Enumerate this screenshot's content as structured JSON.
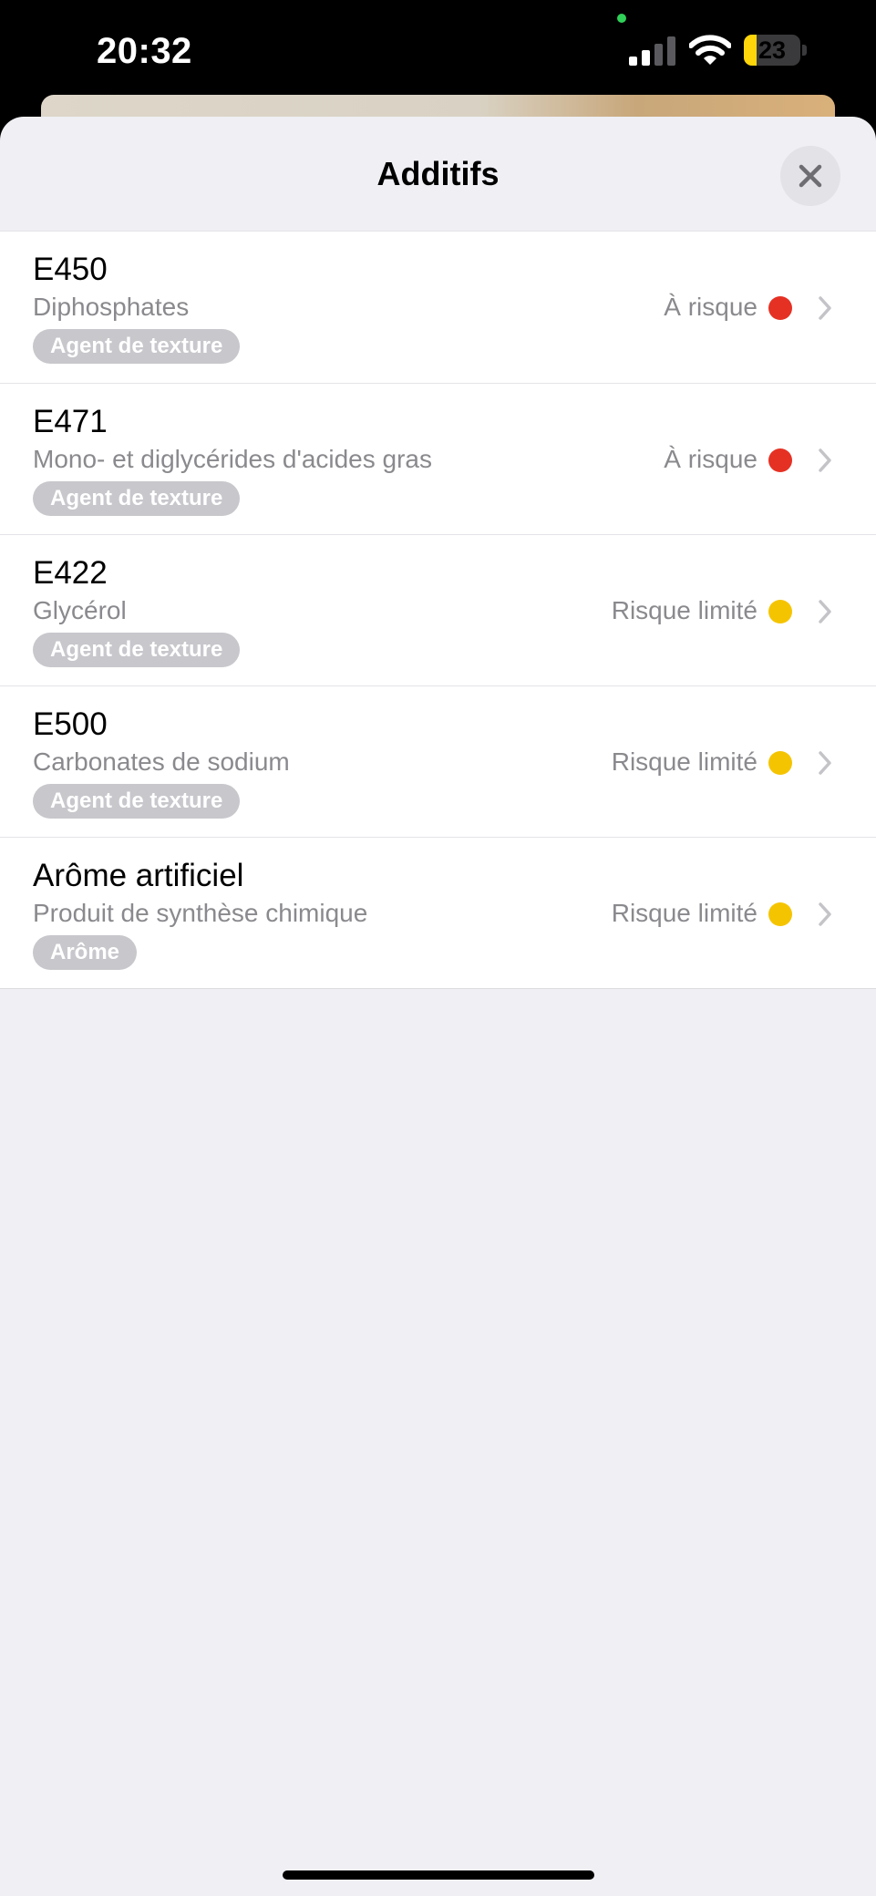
{
  "status_bar": {
    "time": "20:32",
    "battery_level": "23",
    "battery_fraction": 0.23,
    "signal_bars_active": 2,
    "signal_bars_total": 4,
    "icons": [
      "signal-icon",
      "wifi-icon",
      "battery-icon"
    ]
  },
  "sheet": {
    "title": "Additifs",
    "close_icon": "close-icon"
  },
  "additives": [
    {
      "code": "E450",
      "name": "Diphosphates",
      "tag": "Agent de texture",
      "risk": "À risque",
      "risk_color": "#e53124"
    },
    {
      "code": "E471",
      "name": "Mono- et diglycérides d'acides gras",
      "tag": "Agent de texture",
      "risk": "À risque",
      "risk_color": "#e53124"
    },
    {
      "code": "E422",
      "name": "Glycérol",
      "tag": "Agent de texture",
      "risk": "Risque limité",
      "risk_color": "#f5c400"
    },
    {
      "code": "E500",
      "name": "Carbonates de sodium",
      "tag": "Agent de texture",
      "risk": "Risque limité",
      "risk_color": "#f5c400"
    },
    {
      "code": "Arôme artificiel",
      "name": "Produit de synthèse chimique",
      "tag": "Arôme",
      "risk": "Risque limité",
      "risk_color": "#f5c400"
    }
  ],
  "colors": {
    "sheet_background": "#efeff4",
    "tag_background": "#c7c7cc",
    "secondary_text": "#8a8a8e",
    "risk_high": "#e53124",
    "risk_limited": "#f5c400"
  }
}
